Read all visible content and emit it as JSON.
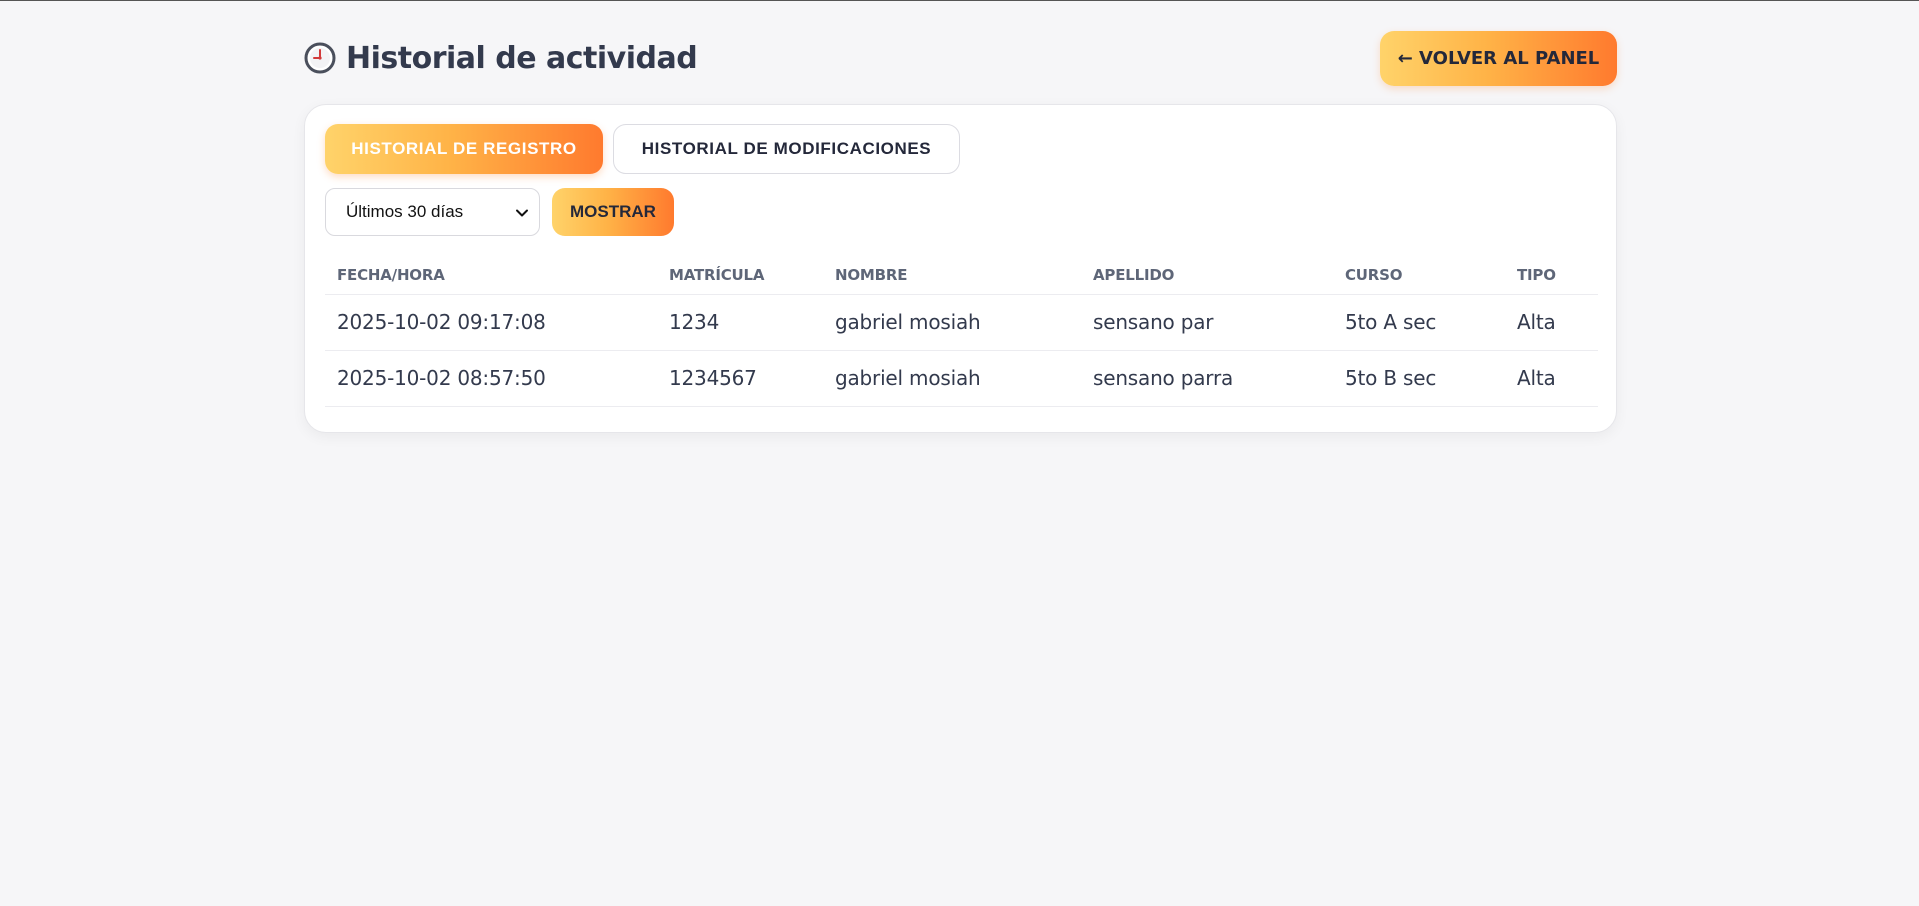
{
  "header": {
    "title": "Historial de actividad",
    "title_icon": "clock-icon",
    "back_button": "← VOLVER AL PANEL"
  },
  "tabs": [
    {
      "label": "HISTORIAL DE REGISTRO",
      "active": true
    },
    {
      "label": "HISTORIAL DE MODIFICACIONES",
      "active": false
    }
  ],
  "filter": {
    "range_selected": "Últimos 30 días",
    "show_button": "MOSTRAR"
  },
  "table": {
    "columns": [
      "FECHA/HORA",
      "MATRÍCULA",
      "NOMBRE",
      "APELLIDO",
      "CURSO",
      "TIPO"
    ],
    "rows": [
      [
        "2025-10-02 09:17:08",
        "1234",
        "gabriel mosiah",
        "sensano par",
        "5to A sec",
        "Alta"
      ],
      [
        "2025-10-02 08:57:50",
        "1234567",
        "gabriel mosiah",
        "sensano parra",
        "5to B sec",
        "Alta"
      ]
    ]
  },
  "colors": {
    "accent_start": "#ffd36a",
    "accent_end": "#ff7a2e",
    "background": "#f6f6f8",
    "text": "#333a4d"
  }
}
